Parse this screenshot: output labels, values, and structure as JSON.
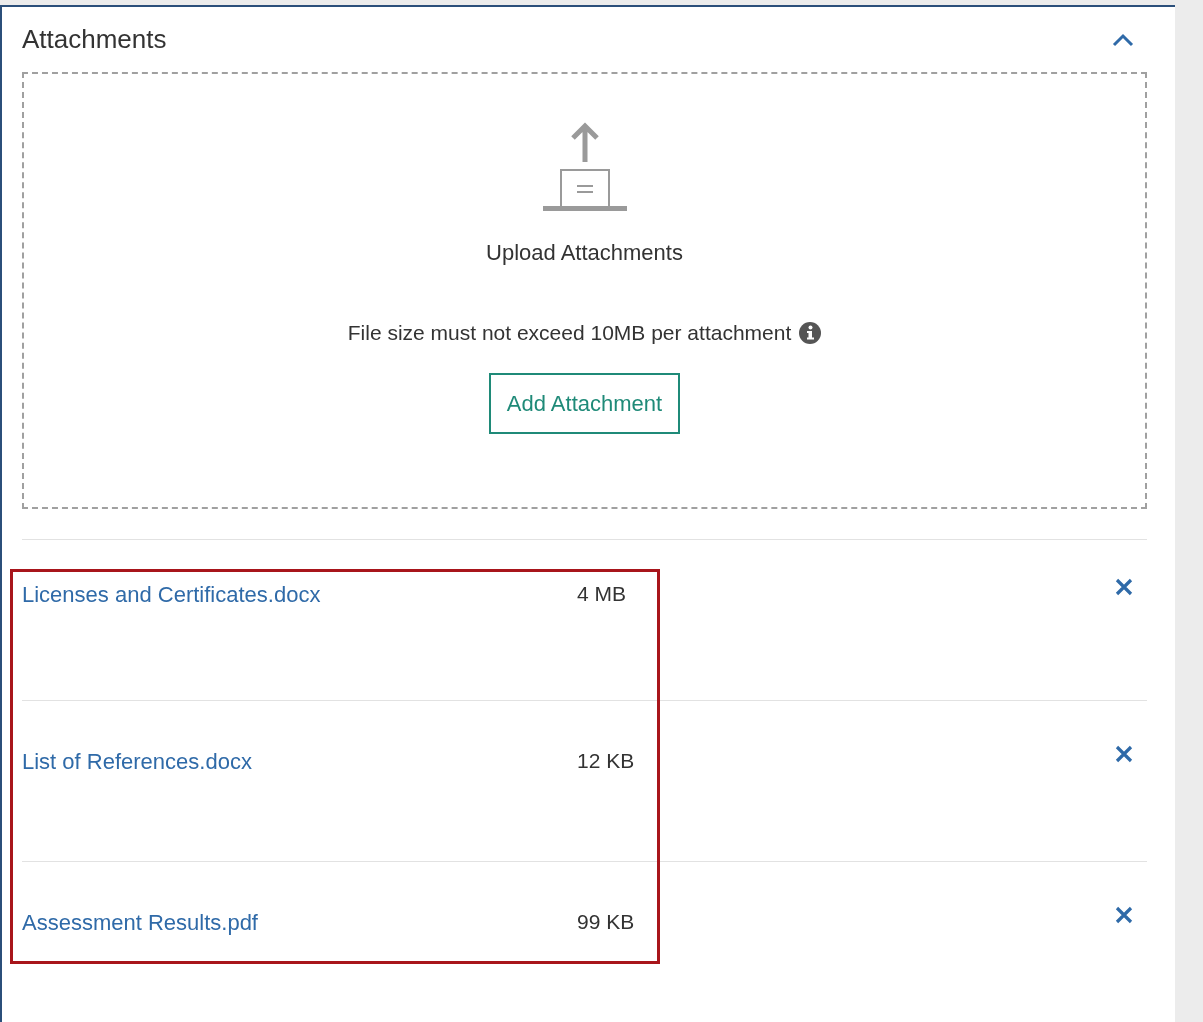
{
  "panel": {
    "title": "Attachments",
    "expanded": true
  },
  "dropzone": {
    "heading": "Upload Attachments",
    "note": "File size must not exceed 10MB per attachment",
    "button": "Add Attachment"
  },
  "file_list": {
    "highlighted": true,
    "files": [
      {
        "name": "Licenses and Certificates.docx",
        "size": "4 MB"
      },
      {
        "name": "List of References.docx",
        "size": "12 KB"
      },
      {
        "name": "Assessment Results.pdf",
        "size": "99 KB"
      }
    ]
  }
}
